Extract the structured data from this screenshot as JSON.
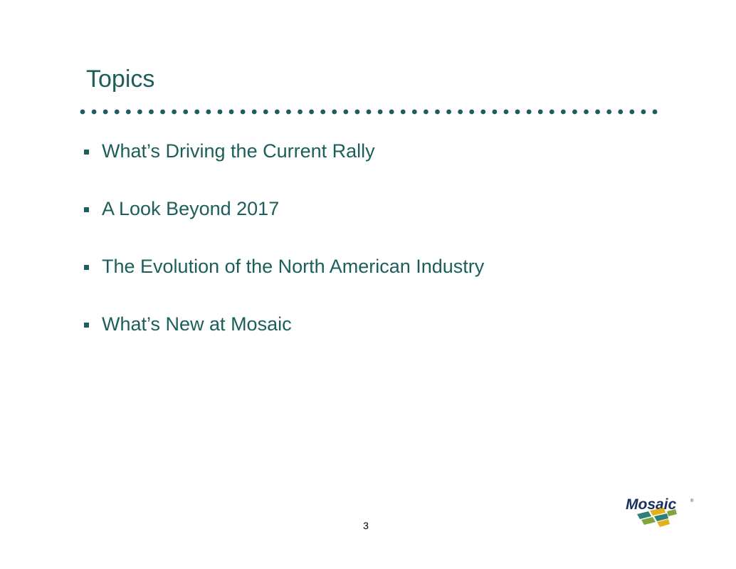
{
  "slide": {
    "title": "Topics",
    "bullets": [
      "What’s Driving the Current Rally",
      "A Look Beyond 2017",
      "The Evolution of the North American Industry",
      "What’s New at Mosaic"
    ],
    "page_number": "3"
  },
  "logo": {
    "text": "Mosaic",
    "icon": "mosaic-logo"
  },
  "colors": {
    "title_teal": "#1c5f5a",
    "dot_divider": "#1c5f5a",
    "logo_navy": "#1b2f5e",
    "logo_green": "#7da73a",
    "logo_yellow": "#e3b11a",
    "logo_teal": "#2f7f76"
  }
}
